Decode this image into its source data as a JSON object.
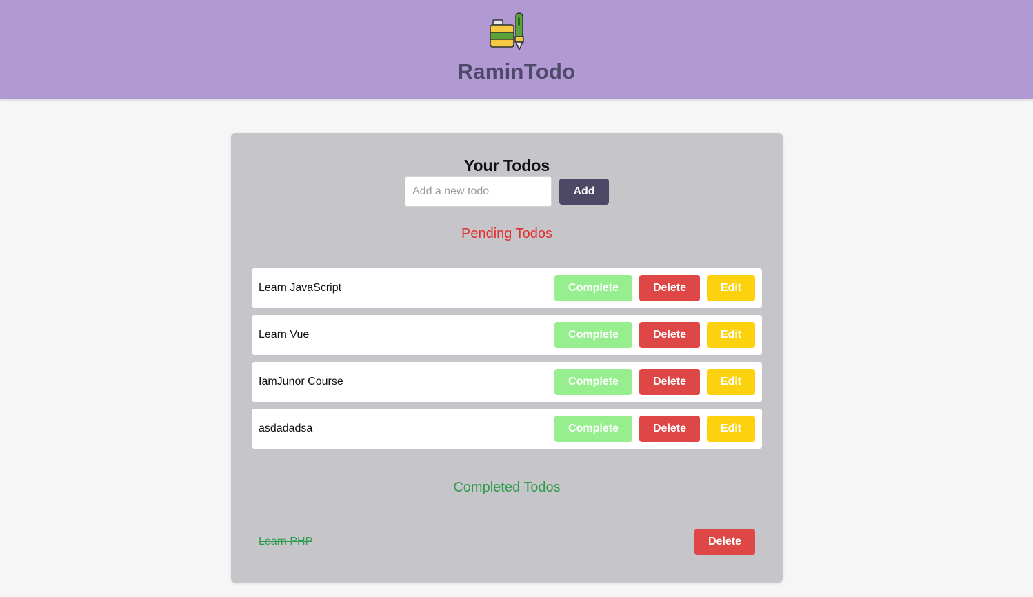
{
  "app": {
    "title": "RaminTodo",
    "logo_icon": "ink-pen-icon"
  },
  "main": {
    "heading": "Your Todos",
    "input_placeholder": "Add a new todo",
    "input_value": "",
    "add_label": "Add"
  },
  "pending": {
    "title": "Pending Todos",
    "items": [
      {
        "text": "Learn JavaScript",
        "complete_label": "Complete",
        "delete_label": "Delete",
        "edit_label": "Edit"
      },
      {
        "text": "Learn Vue",
        "complete_label": "Complete",
        "delete_label": "Delete",
        "edit_label": "Edit"
      },
      {
        "text": "IamJunor Course",
        "complete_label": "Complete",
        "delete_label": "Delete",
        "edit_label": "Edit"
      },
      {
        "text": "asdadadsa",
        "complete_label": "Complete",
        "delete_label": "Delete",
        "edit_label": "Edit"
      }
    ]
  },
  "completed": {
    "title": "Completed Todos",
    "items": [
      {
        "text": "Learn PHP",
        "delete_label": "Delete"
      }
    ]
  },
  "colors": {
    "header_bg": "#b199d3",
    "brand_text": "#4f4969",
    "card_bg": "#c6c6ca",
    "add_button": "#4c4865",
    "complete_button": "#97ee8f",
    "delete_button": "#df4646",
    "edit_button": "#fcd10d",
    "pending_title": "#e32f2f",
    "completed_title": "#2e9c4c"
  }
}
